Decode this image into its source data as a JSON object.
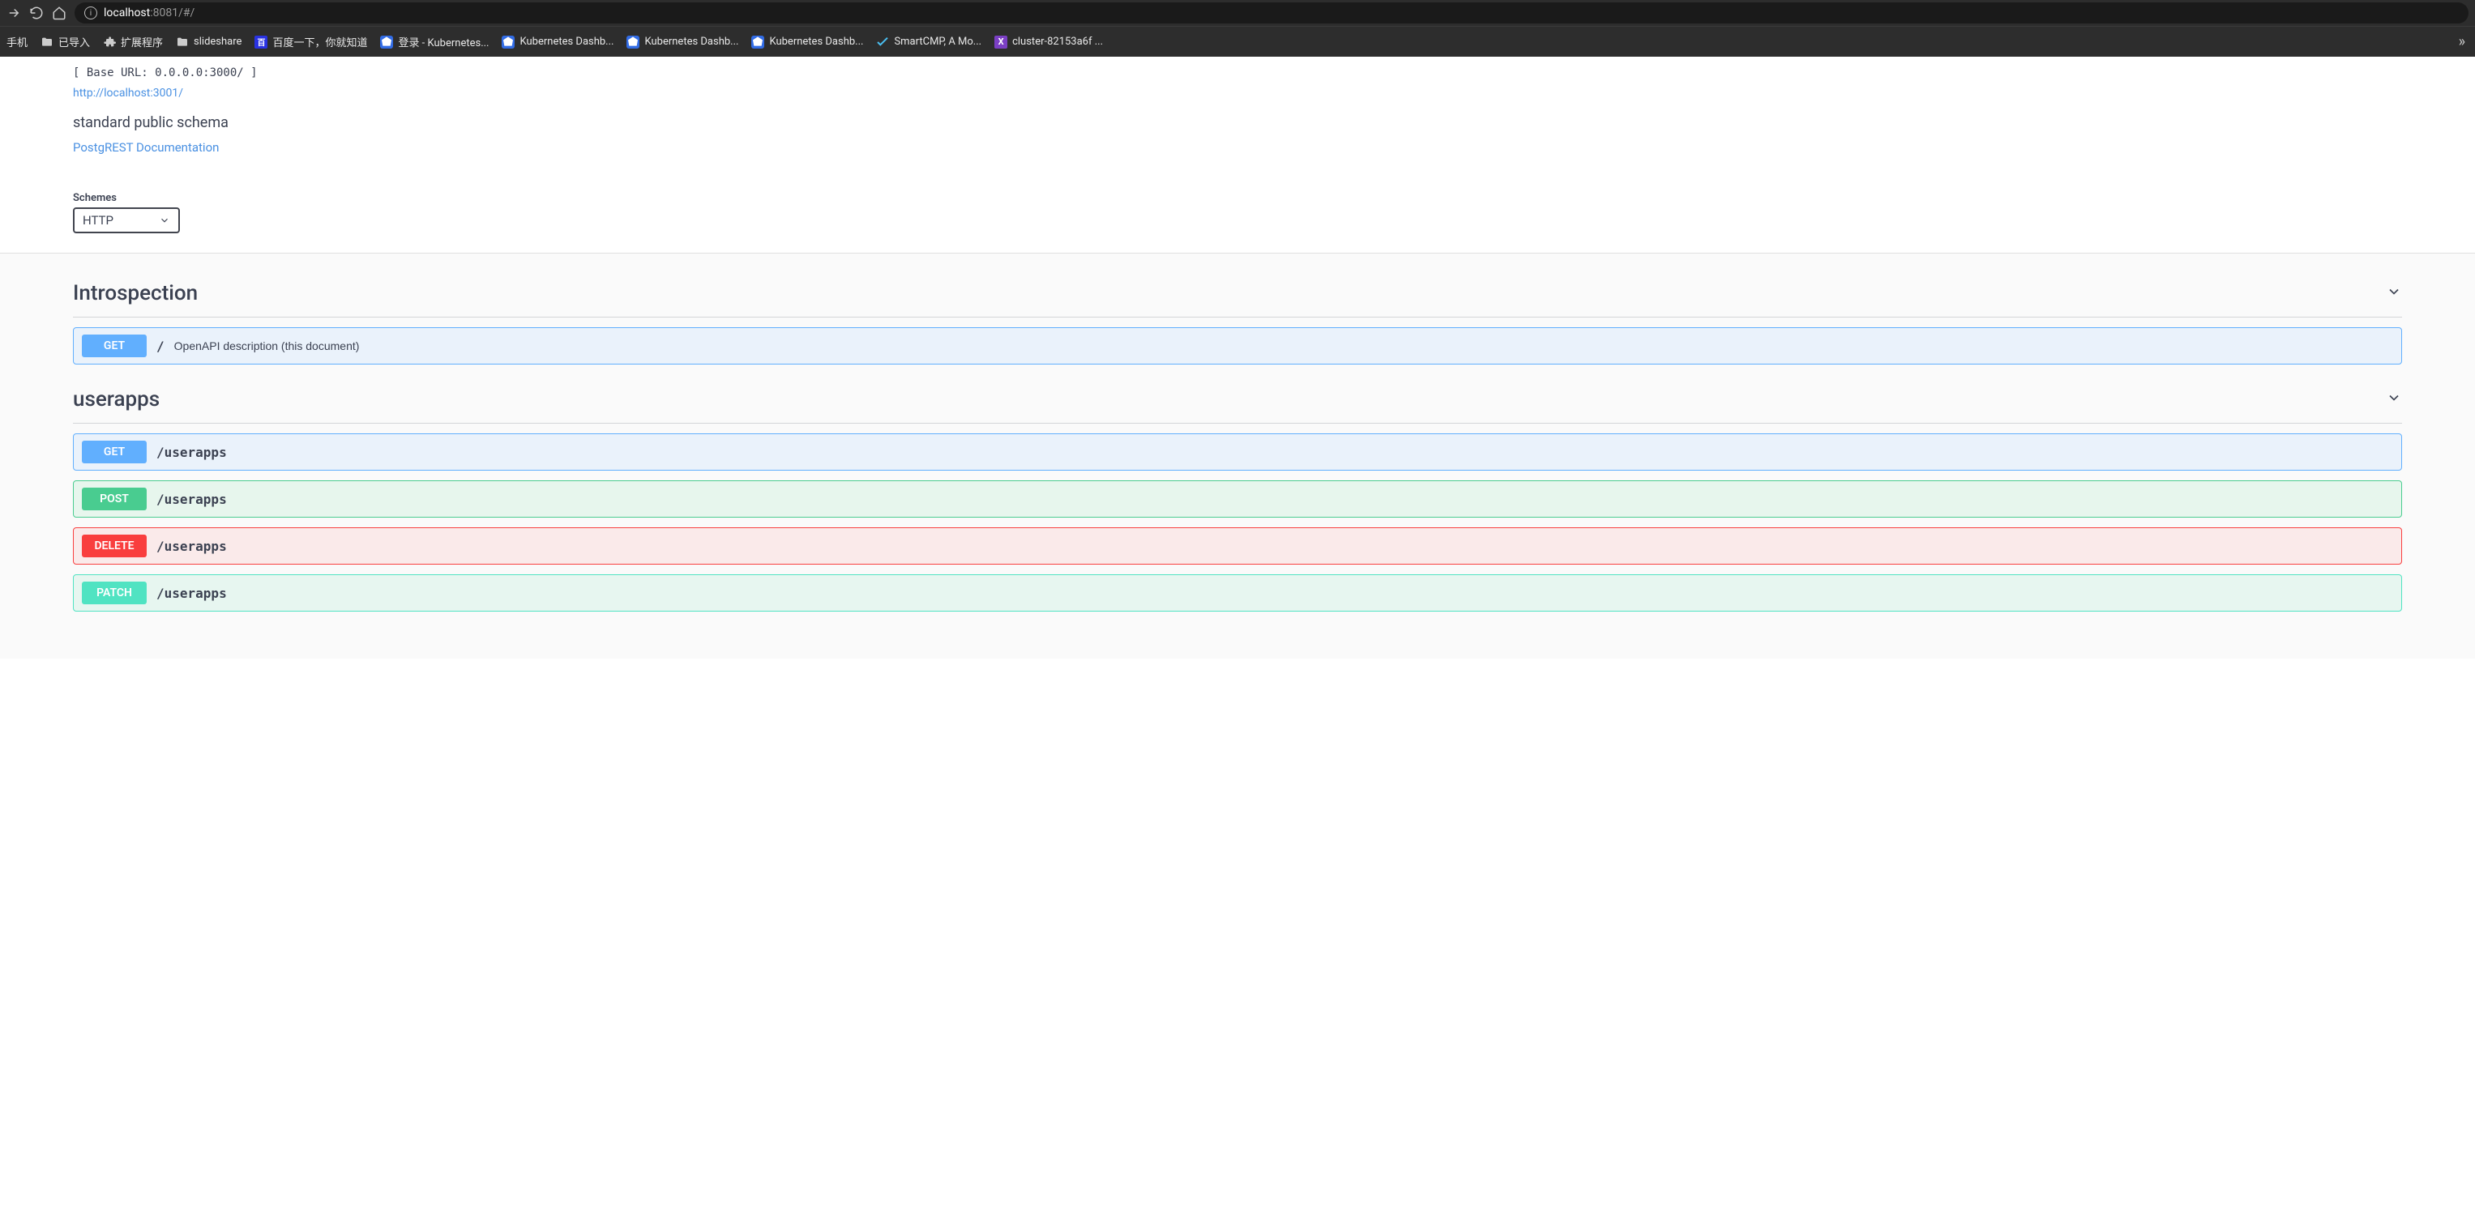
{
  "browser": {
    "url_host": "localhost",
    "url_port_path": ":8081/#/",
    "bookmarks": [
      {
        "label": "手机",
        "icon": "phone"
      },
      {
        "label": "已导入",
        "icon": "folder"
      },
      {
        "label": "扩展程序",
        "icon": "ext"
      },
      {
        "label": "slideshare",
        "icon": "folder"
      },
      {
        "label": "百度一下，你就知道",
        "icon": "baidu"
      },
      {
        "label": "登录 - Kubernetes...",
        "icon": "k8s"
      },
      {
        "label": "Kubernetes Dashb...",
        "icon": "k8s"
      },
      {
        "label": "Kubernetes Dashb...",
        "icon": "k8s"
      },
      {
        "label": "Kubernetes Dashb...",
        "icon": "k8s"
      },
      {
        "label": "SmartCMP, A Mo...",
        "icon": "smartcmp"
      },
      {
        "label": "cluster-82153a6f ...",
        "icon": "x"
      }
    ]
  },
  "api": {
    "base_url": "[ Base URL: 0.0.0.0:3000/ ]",
    "spec_url": "http://localhost:3001/",
    "description": "standard public schema",
    "doc_link": "PostgREST Documentation"
  },
  "schemes": {
    "label": "Schemes",
    "selected": "HTTP"
  },
  "tags": [
    {
      "name": "Introspection",
      "operations": [
        {
          "method": "GET",
          "path": "/",
          "summary": "OpenAPI description (this document)",
          "class": "op-get"
        }
      ]
    },
    {
      "name": "userapps",
      "operations": [
        {
          "method": "GET",
          "path": "/userapps",
          "summary": "",
          "class": "op-get"
        },
        {
          "method": "POST",
          "path": "/userapps",
          "summary": "",
          "class": "op-post"
        },
        {
          "method": "DELETE",
          "path": "/userapps",
          "summary": "",
          "class": "op-delete"
        },
        {
          "method": "PATCH",
          "path": "/userapps",
          "summary": "",
          "class": "op-patch"
        }
      ]
    }
  ]
}
